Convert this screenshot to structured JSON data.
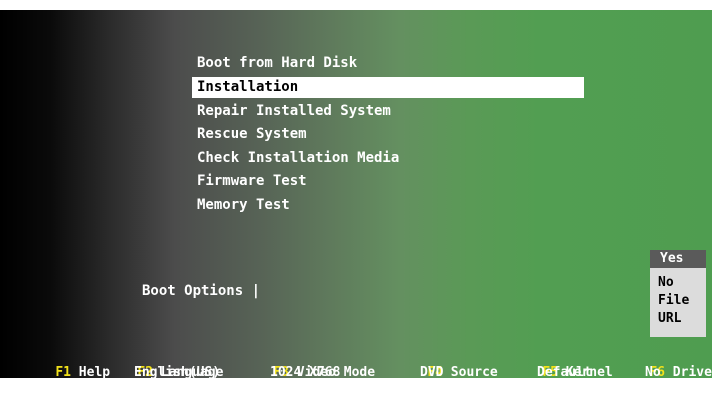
{
  "menu": {
    "items": [
      {
        "label": "Boot from Hard Disk"
      },
      {
        "label": "Installation"
      },
      {
        "label": "Repair Installed System"
      },
      {
        "label": "Rescue System"
      },
      {
        "label": "Check Installation Media"
      },
      {
        "label": "Firmware Test"
      },
      {
        "label": "Memory Test"
      }
    ],
    "selected": "Installation"
  },
  "boot_options": {
    "label": "Boot Options |",
    "value": ""
  },
  "driver_popup": {
    "options": [
      {
        "label": "Yes"
      },
      {
        "label": "No"
      },
      {
        "label": "File"
      },
      {
        "label": "URL"
      }
    ],
    "selected": "Yes"
  },
  "function_keys": [
    {
      "key": "F1",
      "label": "Help",
      "value": ""
    },
    {
      "key": "F2",
      "label": "Language",
      "value": "English(US)"
    },
    {
      "key": "F3",
      "label": "Video Mode",
      "value": "1024 X768"
    },
    {
      "key": "F4",
      "label": "Source",
      "value": "DVD"
    },
    {
      "key": "F5",
      "label": "Kernel",
      "value": "Default"
    },
    {
      "key": "F6",
      "label": "Driver",
      "value": "No"
    }
  ],
  "colors": {
    "fkey": "#f2e21a",
    "selection_bg": "#ffffff",
    "background_green": "#4f9d50"
  }
}
